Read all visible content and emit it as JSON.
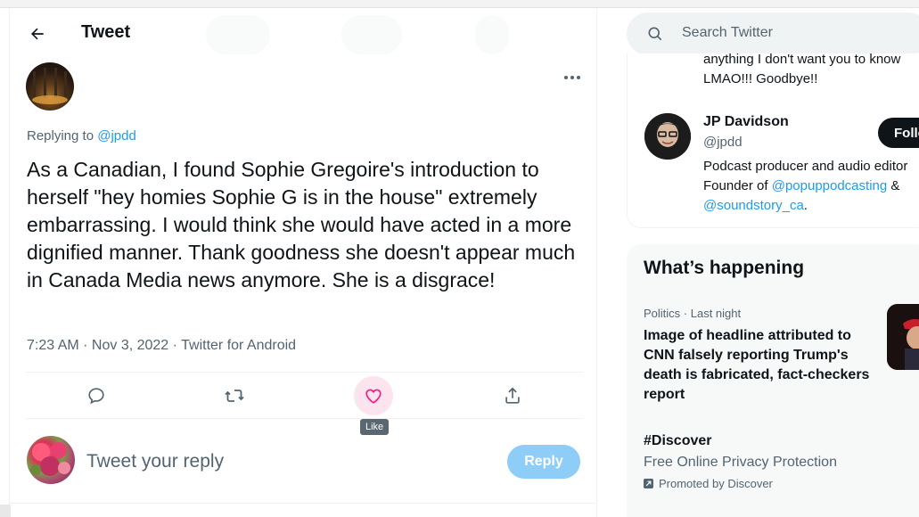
{
  "header": {
    "title": "Tweet"
  },
  "tweet": {
    "replying_prefix": "Replying to",
    "replying_handle": "@jpdd",
    "text": "As a Canadian, I found Sophie Gregoire's introduction to herself \"hey homies Sophie G is in the house\" extremely embarrassing. I would think she would have acted in a more dignified manner. Thank goodness she doesn't appear much in Canada Media news anymore. She is a disgrace!",
    "timestamp": "7:23 AM · Nov 3, 2022 · Twitter for Android"
  },
  "actions": {
    "reply_icon": "comment-icon",
    "retweet_icon": "retweet-icon",
    "like_icon": "heart-icon",
    "share_icon": "share-icon",
    "like_tooltip": "Like"
  },
  "composer": {
    "placeholder": "Tweet your reply",
    "reply_button": "Reply"
  },
  "search": {
    "placeholder": "Search Twitter"
  },
  "who_to_follow": {
    "previous_bio_line1": "anything I don't want you to know",
    "previous_bio_line2": "LMAO!!! Goodbye!!",
    "name": "JP Davidson",
    "handle": "@jpdd",
    "follow_label": "Follow",
    "bio_line1": "Podcast producer and audio editor",
    "bio_line2_prefix": "Founder of ",
    "bio_link1": "@popuppodcasting",
    "bio_line2_suffix": " &",
    "bio_link2": "@soundstory_ca",
    "bio_line3_suffix": "."
  },
  "whats_happening": {
    "title": "What’s happening",
    "trend_meta": "Politics · Last night",
    "trend_headline": "Image of headline attributed to CNN falsely reporting Trump's death is fabricated, fact-checkers report",
    "promo_tag": "#Discover",
    "promo_desc": "Free Online Privacy Protection",
    "promo_by": "Promoted by Discover"
  },
  "colors": {
    "accent": "#1d9bf0",
    "like_hover": "#f91880",
    "text_primary": "#0f1419",
    "text_secondary": "#536471",
    "reply_button_disabled": "#8ecdf7"
  }
}
